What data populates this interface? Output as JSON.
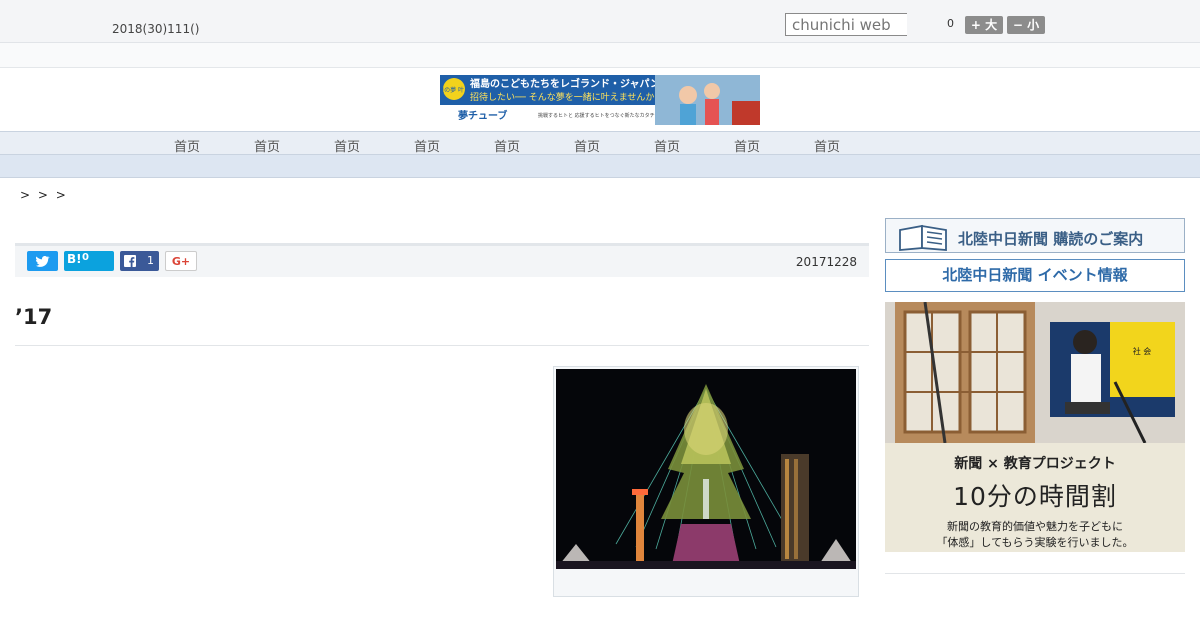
{
  "header": {
    "date": "2018(30)111()",
    "search_placeholder": "chunichi web",
    "zoom_level": "0",
    "font_larger": "+ 大",
    "font_smaller": "− 小"
  },
  "banner": {
    "line1": "福島のこどもたちをレゴランド・ジャパンに",
    "line2": "招待したい── そんな夢を一緒に叶えませんか?",
    "brand": "夢チューブ",
    "tagline": "挑戦するヒトと 応援するヒトをつなぐ新たなカタチ",
    "badge": "北陸の夢 叶える"
  },
  "nav": {
    "items": [
      "首页",
      "首页",
      "首页",
      "首页",
      "首页",
      "首页",
      "首页",
      "首页",
      "首页"
    ]
  },
  "breadcrumb": "> >   >",
  "article": {
    "share": {
      "hatena_label": "B!",
      "hatena_count": "0",
      "facebook_count": "1",
      "gplus": "G+"
    },
    "date": "20171228",
    "headline": "’17"
  },
  "sidebar": {
    "subscribe": {
      "text": "北陸中日新聞 購読のご案内"
    },
    "events": {
      "text": "北陸中日新聞 イベント情報"
    },
    "edu": {
      "line1": "新聞 × 教育プロジェクト",
      "line2": "10分の時間割",
      "line3": "新聞の教育的価値や魅力を子どもに",
      "line4": "「体感」してもらう実験を行いました。",
      "board_text": "社 会"
    }
  },
  "colors": {
    "twitter": "#1d9bf0",
    "hatena": "#0ba2de",
    "facebook": "#3b5998",
    "nav_bg": "#e9eef5"
  }
}
